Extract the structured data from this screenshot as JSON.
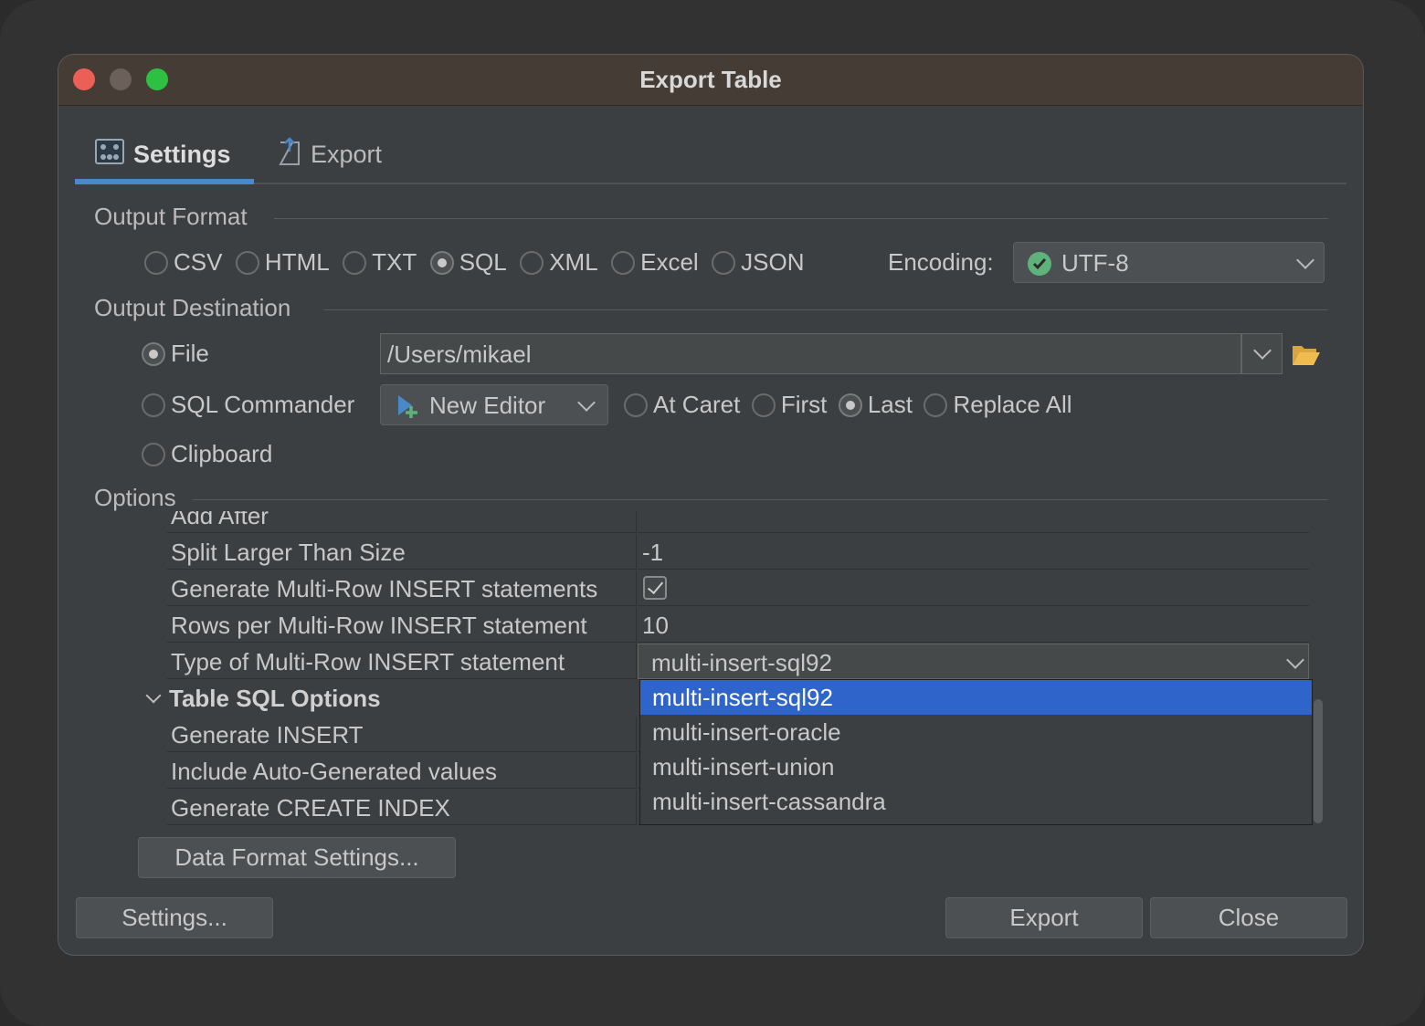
{
  "window": {
    "title": "Export Table"
  },
  "tabs": [
    {
      "label": "Settings",
      "icon": "settings-sliders-icon",
      "active": true
    },
    {
      "label": "Export",
      "icon": "export-document-icon",
      "active": false
    }
  ],
  "output_format": {
    "section_label": "Output Format",
    "formats": [
      "CSV",
      "HTML",
      "TXT",
      "SQL",
      "XML",
      "Excel",
      "JSON"
    ],
    "selected": "SQL",
    "encoding_label": "Encoding:",
    "encoding_value": "UTF-8"
  },
  "output_destination": {
    "section_label": "Output Destination",
    "file_label": "File",
    "file_path": "/Users/mikael",
    "sql_commander_label": "SQL Commander",
    "editor_value": "New Editor",
    "position_options": [
      "At Caret",
      "First",
      "Last",
      "Replace All"
    ],
    "selected_position": "Last",
    "clipboard_label": "Clipboard",
    "selected_destination": "File"
  },
  "options": {
    "section_label": "Options",
    "rows": [
      {
        "key": "Add After",
        "value": ""
      },
      {
        "key": "Split Larger Than Size",
        "value": "-1"
      },
      {
        "key": "Generate Multi-Row INSERT statements",
        "value": "checked"
      },
      {
        "key": "Rows per Multi-Row INSERT statement",
        "value": "10"
      },
      {
        "key": "Type of Multi-Row INSERT statement",
        "value": "multi-insert-sql92"
      }
    ],
    "group_label": "Table SQL Options",
    "group_rows": [
      {
        "key": "Generate INSERT"
      },
      {
        "key": "Include Auto-Generated values"
      },
      {
        "key": "Generate CREATE INDEX"
      }
    ],
    "dropdown_options": [
      "multi-insert-sql92",
      "multi-insert-oracle",
      "multi-insert-union",
      "multi-insert-cassandra"
    ],
    "dropdown_selected": "multi-insert-sql92"
  },
  "buttons": {
    "data_format": "Data Format Settings...",
    "settings": "Settings...",
    "export": "Export",
    "close": "Close"
  },
  "colors": {
    "accent": "#4a88c7",
    "selection": "#2f65ca",
    "bg": "#3c3f41"
  }
}
